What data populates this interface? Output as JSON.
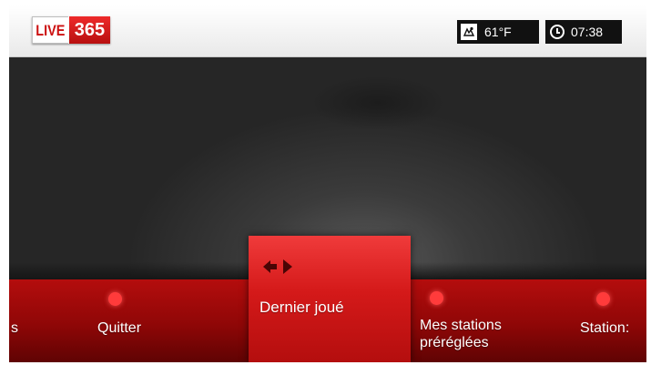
{
  "logo": {
    "live": "LIVE",
    "number": "365"
  },
  "status": {
    "temperature": "61°F",
    "time": "07:38"
  },
  "menu": {
    "items": [
      {
        "label": "s"
      },
      {
        "label": "Quitter"
      },
      {
        "label": "Dernier joué"
      },
      {
        "label": "Mes stations",
        "label2": "préréglées"
      },
      {
        "label": "Station:"
      }
    ]
  },
  "icons": {
    "weather": "weather-icon",
    "clock": "clock-icon",
    "quit": "exit-icon",
    "last_played": "left-right-arrows-icon",
    "presets": "heart-icon",
    "stations": "station-icon"
  },
  "colors": {
    "accent": "#d41919",
    "menu_dark": "#8f0707"
  }
}
